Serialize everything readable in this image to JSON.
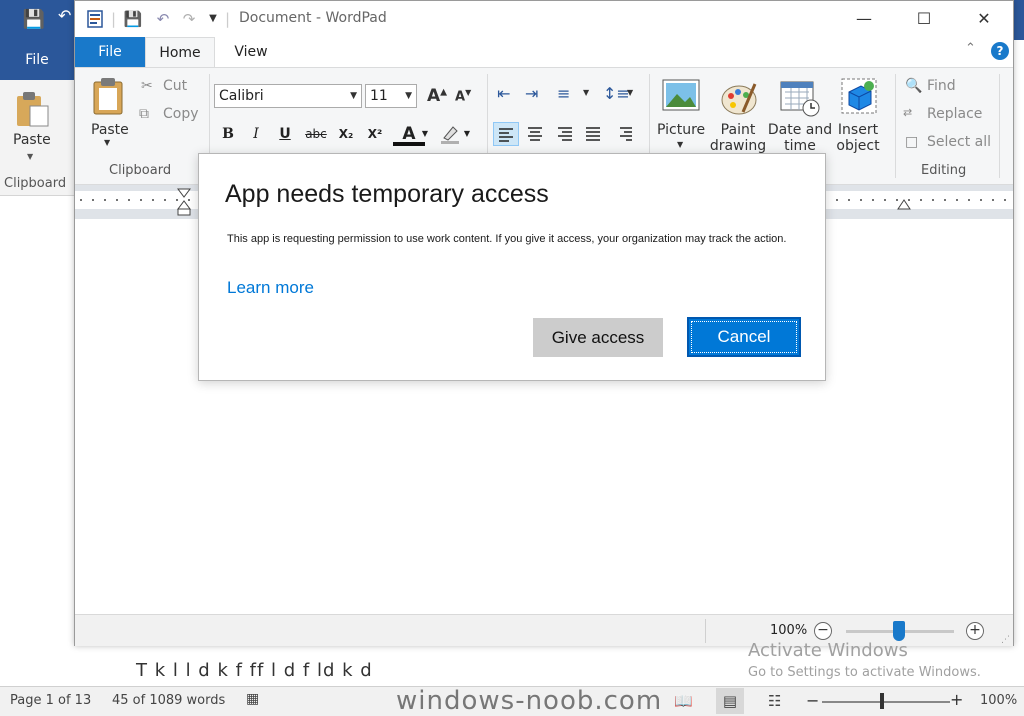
{
  "background_app": {
    "file_tab": "File",
    "paste_label": "Paste",
    "clipboard_label": "Clipboard",
    "doc_text_fragment": "T  k  l    l     d  k    f  ff  l  d    f    ld    k     d",
    "status": {
      "page": "Page 1 of 13",
      "words": "45 of 1089 words",
      "zoom": "100%"
    },
    "watermark": "windows-noob.com"
  },
  "activation": {
    "line1": "Activate Windows",
    "line2": "Go to Settings to activate Windows."
  },
  "wordpad": {
    "title": "Document - WordPad",
    "tabs": {
      "file": "File",
      "home": "Home",
      "view": "View"
    },
    "clipboard": {
      "paste": "Paste",
      "cut": "Cut",
      "copy": "Copy",
      "label": "Clipboard"
    },
    "font": {
      "family": "Calibri",
      "size": "11",
      "bold": "B",
      "italic": "I",
      "underline": "U",
      "strike": "abc",
      "subscript": "X₂",
      "superscript": "X²",
      "grow": "A",
      "shrink": "A",
      "color_letter": "A"
    },
    "insert": {
      "picture": "Picture",
      "paint_drawing_1": "Paint",
      "paint_drawing_2": "drawing",
      "date_time_1": "Date and",
      "date_time_2": "time",
      "insert_object_1": "Insert",
      "insert_object_2": "object"
    },
    "editing": {
      "find": "Find",
      "replace": "Replace",
      "select_all": "Select all",
      "label": "Editing"
    },
    "status": {
      "zoom": "100%",
      "zoom_level_percent": 100
    }
  },
  "dialog": {
    "title": "App needs temporary access",
    "message": "This app is requesting permission to use work content. If you give it access, your organization may track the action.",
    "link": "Learn more",
    "give_access": "Give access",
    "cancel": "Cancel"
  },
  "colors": {
    "word_blue": "#2b579a",
    "wordpad_file_tab": "#1979ca",
    "dialog_accent": "#0078d7",
    "secondary_button": "#cccccc"
  }
}
